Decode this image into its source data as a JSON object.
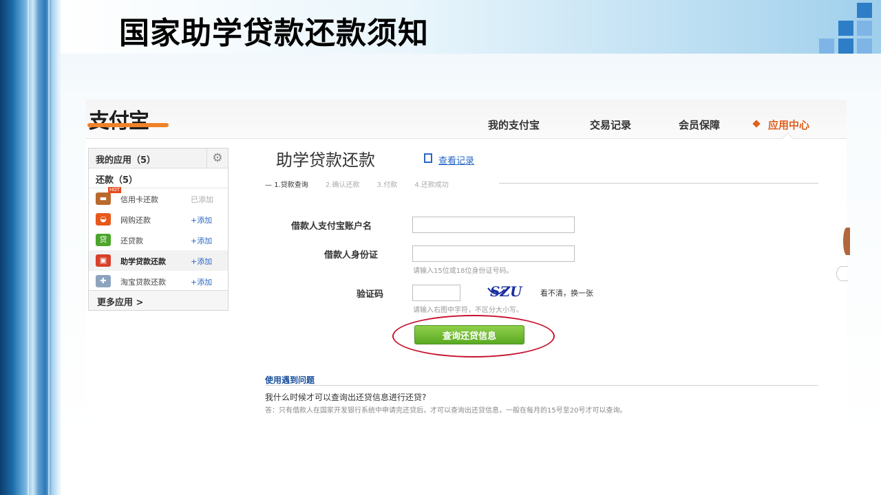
{
  "slide": {
    "title": "国家助学贷款还款须知",
    "colors": {
      "accent_blue": "#2e7ec7",
      "light_blue": "#7fb5e6"
    }
  },
  "app": {
    "logo": "支付宝",
    "nav": [
      {
        "label": "我的支付宝"
      },
      {
        "label": "交易记录"
      },
      {
        "label": "会员保障"
      },
      {
        "label": "应用中心",
        "active": true
      }
    ]
  },
  "sidebar": {
    "header": "我的应用（5）",
    "gear_icon": "gear-icon",
    "section": "还款（5）",
    "items": [
      {
        "label": "信用卡还款",
        "action": "已添加",
        "badge": "HOT",
        "icon": "credit-card-icon"
      },
      {
        "label": "网购还款",
        "action": "+添加",
        "icon": "shopping-icon"
      },
      {
        "label": "还贷款",
        "action": "+添加",
        "icon": "loan-icon",
        "icon_text": "贷"
      },
      {
        "label": "助学贷款还款",
        "action": "+添加",
        "icon": "student-loan-icon"
      },
      {
        "label": "淘宝贷款还款",
        "action": "+添加",
        "icon": "puzzle-icon"
      }
    ],
    "more": "更多应用 >"
  },
  "main": {
    "title": "助学贷款还款",
    "record_link": "查看记录",
    "steps": [
      "1.贷款查询",
      "2.确认还款",
      "3.付款",
      "4.还款成功"
    ],
    "fields": {
      "account_label": "借款人支付宝账户名",
      "account_value": "",
      "id_label": "借款人身份证",
      "id_value": "",
      "id_hint": "请输入15位或18位身份证号码。",
      "captcha_label": "验证码",
      "captcha_value": "",
      "captcha_text": "SZU",
      "captcha_refresh": "看不清，换一张",
      "captcha_hint": "请输入右图中字符，不区分大小写。"
    },
    "submit_label": "查询还贷信息",
    "help": {
      "title": "使用遇到问题",
      "question": "我什么时候才可以查询出还贷信息进行还贷?",
      "answer": "答：只有借款人在国家开发银行系统中申请完还贷后，才可以查询出还贷信息，一般在每月的15号至20号才可以查询。"
    }
  }
}
